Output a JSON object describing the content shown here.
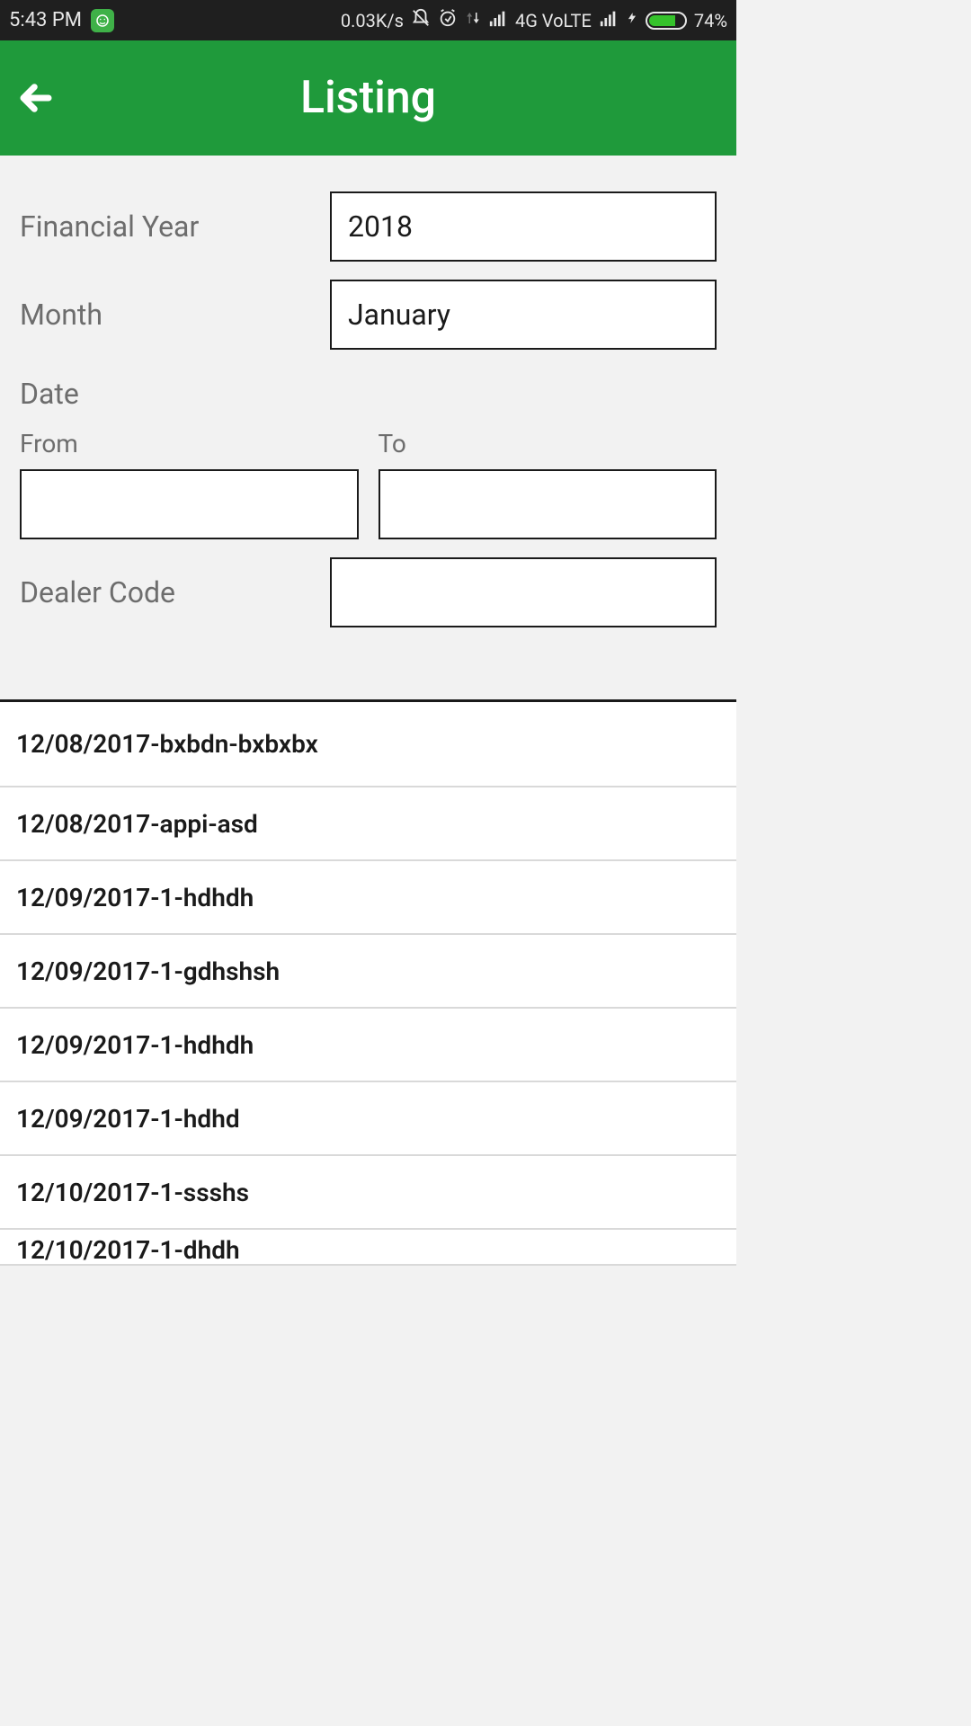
{
  "status_bar": {
    "time": "5:43 PM",
    "data_speed": "0.03K/s",
    "network_label": "4G  VoLTE",
    "battery_pct": "74%"
  },
  "app_bar": {
    "title": "Listing"
  },
  "form": {
    "financial_year_label": "Financial Year",
    "financial_year_value": "2018",
    "month_label": "Month",
    "month_value": "January",
    "date_label": "Date",
    "from_label": "From",
    "from_value": "",
    "to_label": "To",
    "to_value": "",
    "dealer_code_label": "Dealer Code",
    "dealer_code_value": ""
  },
  "list": {
    "items": [
      "12/08/2017-bxbdn-bxbxbx",
      "12/08/2017-appi-asd",
      "12/09/2017-1-hdhdh",
      "12/09/2017-1-gdhshsh",
      "12/09/2017-1-hdhdh",
      "12/09/2017-1-hdhd",
      "12/10/2017-1-ssshs",
      "12/10/2017-1-dhdh"
    ]
  }
}
